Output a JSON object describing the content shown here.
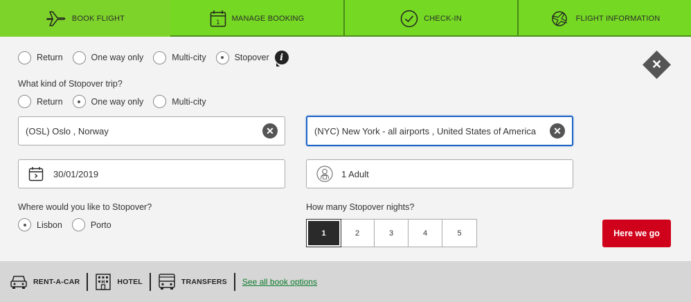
{
  "tabs": [
    {
      "label": "BOOK FLIGHT",
      "icon": "plane-icon"
    },
    {
      "label": "MANAGE BOOKING",
      "icon": "calendar-icon"
    },
    {
      "label": "CHECK-IN",
      "icon": "check-circle-icon"
    },
    {
      "label": "FLIGHT INFORMATION",
      "icon": "flight-info-icon"
    }
  ],
  "trip_type": {
    "options": [
      "Return",
      "One way only",
      "Multi-city",
      "Stopover"
    ],
    "selected": "Stopover"
  },
  "stopover_question": "What kind of Stopover trip?",
  "stopover_trip": {
    "options": [
      "Return",
      "One way only",
      "Multi-city"
    ],
    "selected": "One way only"
  },
  "origin": {
    "value": "(OSL) Oslo , Norway"
  },
  "destination": {
    "value": "(NYC) New York -  all airports , United States of America"
  },
  "date": {
    "value": "30/01/2019"
  },
  "passengers": {
    "value": "1 Adult"
  },
  "stopover_city_question": "Where would you like to Stopover?",
  "stopover_city": {
    "options": [
      "Lisbon",
      "Porto"
    ],
    "selected": "Lisbon"
  },
  "nights_question": "How many Stopover nights?",
  "nights": {
    "options": [
      "1",
      "2",
      "3",
      "4",
      "5"
    ],
    "selected": "1"
  },
  "submit_label": "Here we go",
  "bottom_bar": {
    "items": [
      {
        "label": "RENT-A-CAR",
        "icon": "car-icon"
      },
      {
        "label": "HOTEL",
        "icon": "hotel-icon"
      },
      {
        "label": "TRANSFERS",
        "icon": "bus-icon"
      }
    ],
    "link": "See all book options"
  },
  "colors": {
    "tab_green": "#75d823",
    "submit_red": "#d0021b",
    "focus_blue": "#1e63c4",
    "link_green": "#0a7a2a"
  }
}
